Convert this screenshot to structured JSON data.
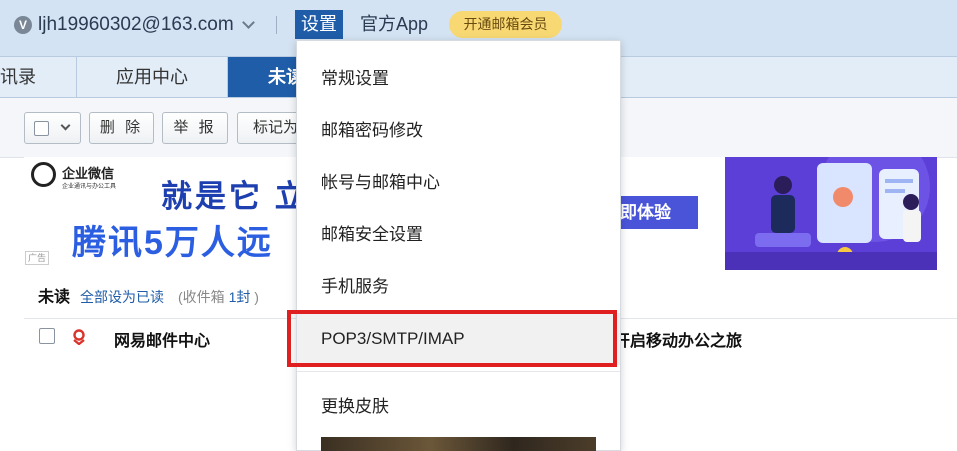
{
  "header": {
    "account_initial": "V",
    "account_email": "ljh19960302@163.com",
    "settings_label": "设置",
    "app_label": "官方App",
    "vip_label": "开通邮箱会员"
  },
  "tabs": [
    {
      "label": "讯录"
    },
    {
      "label": "应用中心"
    },
    {
      "label": "未读"
    }
  ],
  "toolbar": {
    "delete_label": "删 除",
    "report_label": "举 报",
    "mark_label": "标记为"
  },
  "ad": {
    "logo_title": "企业微信",
    "logo_sub": "企业通讯与办公工具",
    "line1": "就是它  立",
    "line2": "腾讯5万人远",
    "cta": "即体验",
    "tag": "广告"
  },
  "unread": {
    "title": "未读",
    "mark_all_read": "全部设为已读",
    "count_prefix": "(收件箱",
    "count_value": "1封",
    "count_suffix": ")"
  },
  "mail_rows": [
    {
      "sender": "网易邮件中心",
      "subject": "开启移动办公之旅"
    }
  ],
  "settings_menu": {
    "items": [
      {
        "label": "常规设置"
      },
      {
        "label": "邮箱密码修改"
      },
      {
        "label": "帐号与邮箱中心"
      },
      {
        "label": "邮箱安全设置"
      },
      {
        "label": "手机服务"
      },
      {
        "label": "POP3/SMTP/IMAP"
      },
      {
        "label": "更换皮肤"
      }
    ],
    "highlighted_index": 5
  },
  "colors": {
    "primary": "#1f5da8",
    "topbar_bg": "#d4e3f3",
    "vip_badge": "#f7d873",
    "highlight_border": "#e02020"
  }
}
